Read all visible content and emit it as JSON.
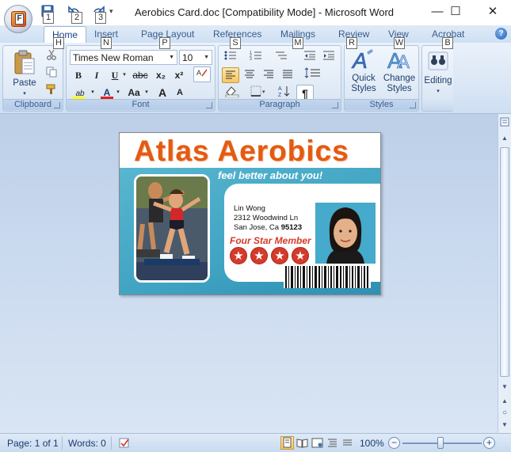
{
  "window": {
    "title": "Aerobics Card.doc [Compatibility Mode] - Microsoft Word",
    "minimize": "—",
    "maximize": "☐",
    "close": "✕"
  },
  "office_button": {
    "letter": "F"
  },
  "quick_access": {
    "keytips": [
      "1",
      "2",
      "3"
    ],
    "more": "▾"
  },
  "tabs": [
    {
      "label": "Home",
      "keytip": "H"
    },
    {
      "label": "Insert",
      "keytip": "N"
    },
    {
      "label": "Page Layout",
      "keytip": "P"
    },
    {
      "label": "References",
      "keytip": "S"
    },
    {
      "label": "Mailings",
      "keytip": "M"
    },
    {
      "label": "Review",
      "keytip": "R"
    },
    {
      "label": "View",
      "keytip": "W"
    },
    {
      "label": "Acrobat",
      "keytip": "B"
    }
  ],
  "help": "?",
  "groups": {
    "clipboard": {
      "label": "Clipboard",
      "paste": "Paste"
    },
    "font": {
      "label": "Font",
      "font_name": "Times New Roman",
      "font_size": "10",
      "bold": "B",
      "italic": "I",
      "underline": "U",
      "strike": "abc",
      "subscript": "x₂",
      "superscript": "x²",
      "highlight": "ab",
      "font_color": "A",
      "change_case": "Aa",
      "grow": "A",
      "shrink": "A"
    },
    "paragraph": {
      "label": "Paragraph",
      "show_marks": "¶"
    },
    "styles": {
      "label": "Styles",
      "quick_styles": "Quick Styles",
      "change_styles": "Change Styles"
    },
    "editing": {
      "label": "Editing"
    }
  },
  "card": {
    "title": "Atlas Aerobics",
    "tagline": "feel better about you!",
    "name": "Lin Wong",
    "street": "2312 Woodwind  Ln",
    "city": "San Jose, Ca",
    "zip": "95123",
    "member_level": "Four Star Member",
    "star_count": 4,
    "colors": {
      "title": "#e35b12",
      "band": "#3fa3c2",
      "star": "#d43b2a"
    }
  },
  "status": {
    "page": "Page: 1 of 1",
    "words": "Words: 0",
    "zoom": "100%",
    "zoom_out": "−",
    "zoom_in": "+"
  },
  "icons": {
    "cut": "cut-icon",
    "copy": "copy-icon",
    "format_painter": "format-painter-icon",
    "bullets": "bullets-icon",
    "numbering": "numbering-icon",
    "multilevel": "multilevel-list-icon",
    "decrease_indent": "decrease-indent-icon",
    "increase_indent": "increase-indent-icon",
    "align_left": "align-left-icon",
    "center": "align-center-icon",
    "align_right": "align-right-icon",
    "justify": "justify-icon",
    "line_spacing": "line-spacing-icon",
    "shading": "shading-icon",
    "borders": "borders-icon",
    "sort": "sort-icon",
    "binoculars": "binoculars-icon"
  }
}
